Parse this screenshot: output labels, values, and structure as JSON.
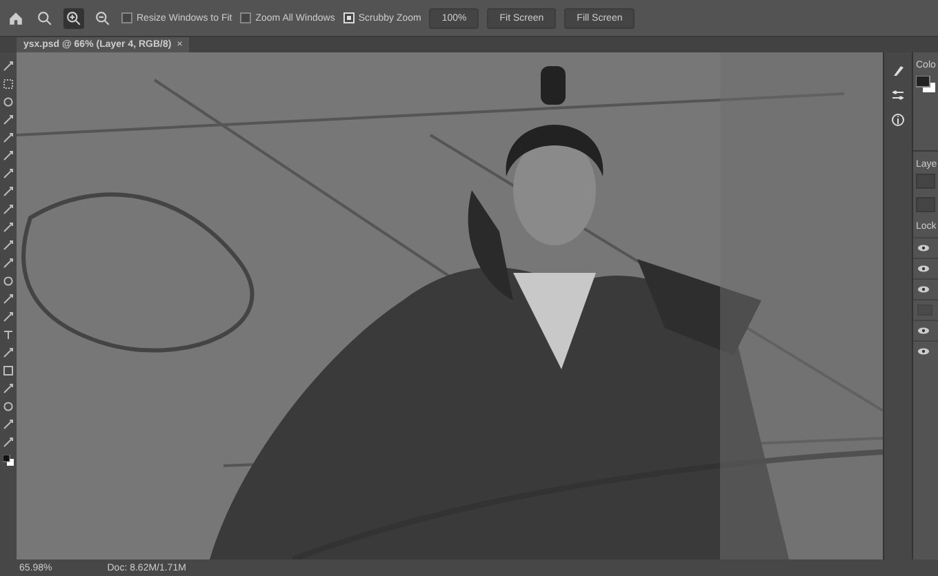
{
  "options_bar": {
    "checkboxes": [
      {
        "label": "Resize Windows to Fit",
        "checked": false
      },
      {
        "label": "Zoom All Windows",
        "checked": false
      },
      {
        "label": "Scrubby Zoom",
        "checked": true
      }
    ],
    "buttons": [
      "100%",
      "Fit Screen",
      "Fill Screen"
    ]
  },
  "document_tab": {
    "title": "ysx.psd @ 66% (Layer 4, RGB/8)",
    "close": "×"
  },
  "panels": {
    "color_title": "Colo",
    "layers_title": "Laye",
    "lock_label": "Lock",
    "layer_rows": [
      {
        "visible": true
      },
      {
        "visible": true
      },
      {
        "visible": true
      },
      {
        "visible": false
      },
      {
        "visible": true
      },
      {
        "visible": true
      }
    ]
  },
  "status_bar": {
    "zoom": "65.98%",
    "doc_size": "Doc: 8.62M/1.71M"
  }
}
